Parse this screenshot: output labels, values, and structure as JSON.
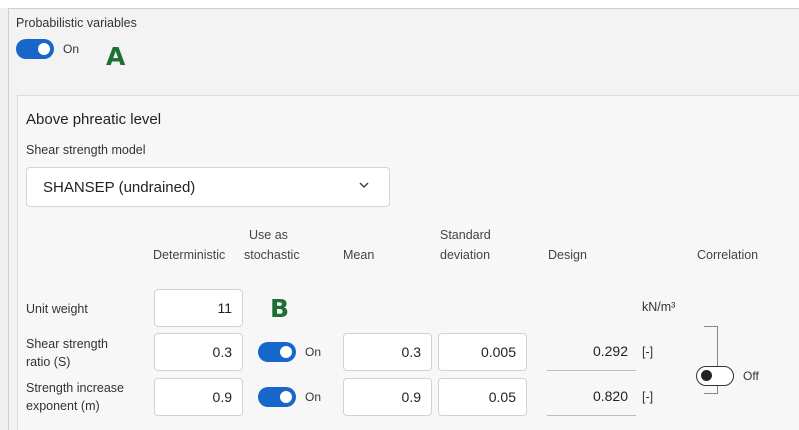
{
  "probabilistic": {
    "label": "Probabilistic variables",
    "toggle_state": "On",
    "marker": "A"
  },
  "panel": {
    "section_title": "Above phreatic level",
    "model_label": "Shear strength model",
    "model_value": "SHANSEP (undrained)"
  },
  "table": {
    "headers": {
      "deterministic": "Deterministic",
      "use_as_line1": "Use as",
      "use_as_line2": "stochastic",
      "mean": "Mean",
      "stddev_line1": "Standard",
      "stddev_line2": "deviation",
      "design": "Design",
      "correlation": "Correlation"
    },
    "marker": "B",
    "rows": [
      {
        "label_line1": "Unit weight",
        "label_line2": "",
        "deterministic": "11",
        "unit": "kN/m³"
      },
      {
        "label_line1": "Shear strength",
        "label_line2": "ratio (S)",
        "deterministic": "0.3",
        "stochastic_state": "On",
        "mean": "0.3",
        "stddev": "0.005",
        "design": "0.292",
        "unit": "[-]"
      },
      {
        "label_line1": "Strength increase",
        "label_line2": "exponent (m)",
        "deterministic": "0.9",
        "stochastic_state": "On",
        "mean": "0.9",
        "stddev": "0.05",
        "design": "0.820",
        "unit": "[-]"
      }
    ],
    "correlation_state": "Off"
  },
  "colors": {
    "toggle_on": "#1766c9",
    "marker": "#1e7032"
  }
}
